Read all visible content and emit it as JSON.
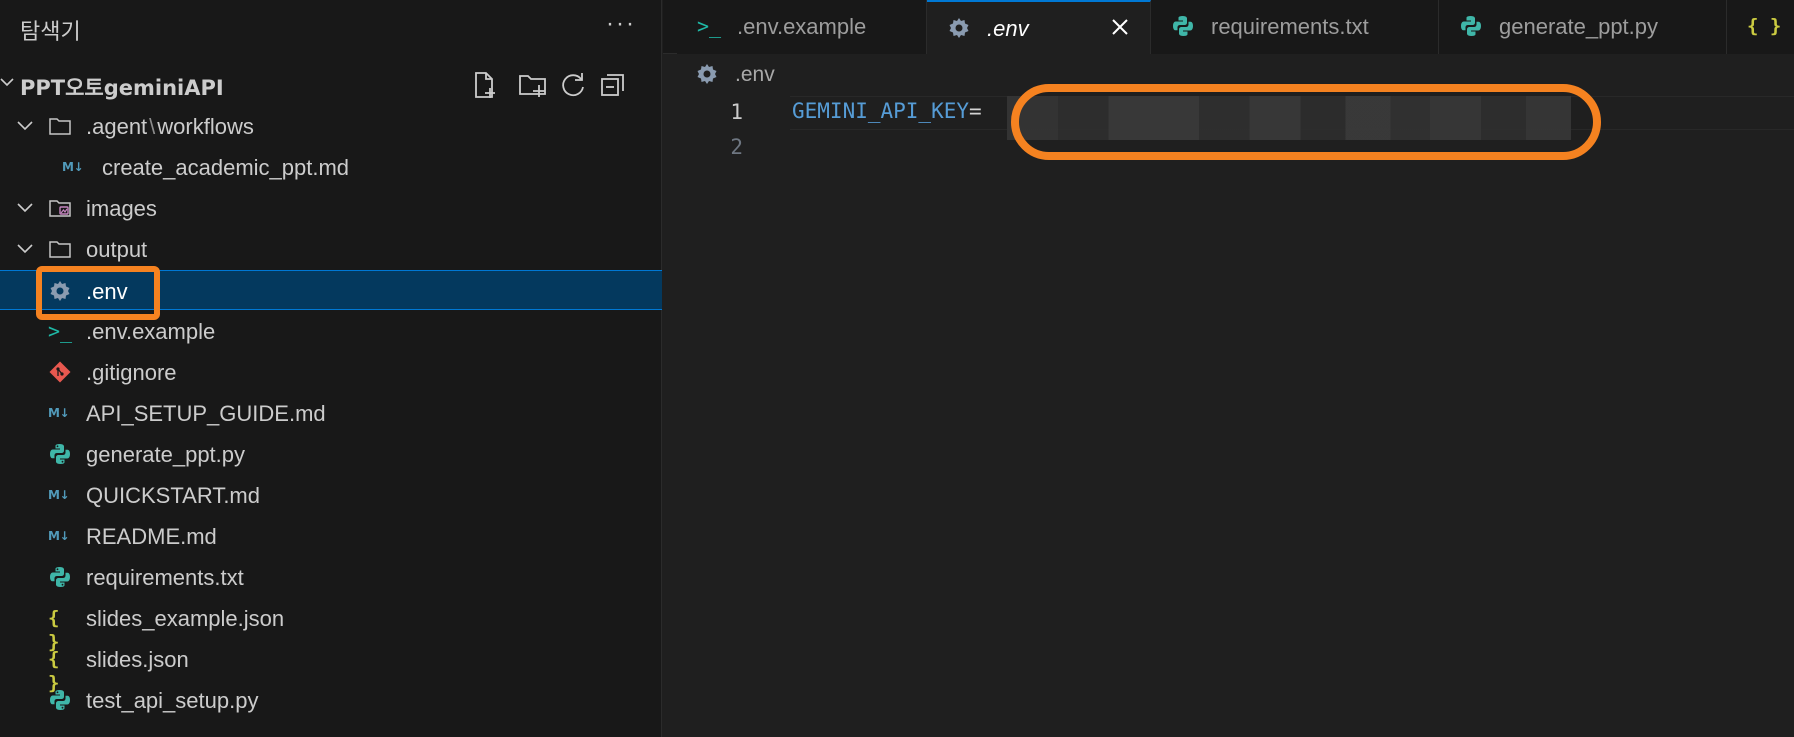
{
  "explorer": {
    "title": "탐색기",
    "more_label": "···",
    "root": {
      "label": "PPT오토geminiAPI",
      "actions": [
        "new-file-icon",
        "new-folder-icon",
        "refresh-icon",
        "collapse-all-icon"
      ]
    },
    "items": [
      {
        "label": ".agent",
        "label_sub": "workflows",
        "kind": "folder",
        "icon": "folder-icon"
      },
      {
        "label": "create_academic_ppt.md",
        "kind": "file",
        "icon": "markdown-icon"
      },
      {
        "label": "images",
        "kind": "folder",
        "icon": "images-folder-icon"
      },
      {
        "label": "output",
        "kind": "folder",
        "icon": "folder-icon"
      },
      {
        "label": ".env",
        "kind": "file",
        "icon": "gear-icon",
        "selected": true
      },
      {
        "label": ".env.example",
        "kind": "file",
        "icon": "terminal-icon"
      },
      {
        "label": ".gitignore",
        "kind": "file",
        "icon": "git-icon"
      },
      {
        "label": "API_SETUP_GUIDE.md",
        "kind": "file",
        "icon": "markdown-icon"
      },
      {
        "label": "generate_ppt.py",
        "kind": "file",
        "icon": "python-icon"
      },
      {
        "label": "QUICKSTART.md",
        "kind": "file",
        "icon": "markdown-icon"
      },
      {
        "label": "README.md",
        "kind": "file",
        "icon": "markdown-icon"
      },
      {
        "label": "requirements.txt",
        "kind": "file",
        "icon": "python-icon"
      },
      {
        "label": "slides_example.json",
        "kind": "file",
        "icon": "json-icon"
      },
      {
        "label": "slides.json",
        "kind": "file",
        "icon": "json-icon"
      },
      {
        "label": "test_api_setup.py",
        "kind": "file",
        "icon": "python-icon"
      }
    ],
    "md_glyph": "M↓",
    "json_glyph": "{ }",
    "term_glyph": ">_"
  },
  "tabs": [
    {
      "label": ".env.example",
      "icon": "terminal-icon",
      "active": false
    },
    {
      "label": ".env",
      "icon": "gear-icon",
      "active": true
    },
    {
      "label": "requirements.txt",
      "icon": "python-icon",
      "active": false
    },
    {
      "label": "generate_ppt.py",
      "icon": "python-icon",
      "active": false
    },
    {
      "label": "{ }",
      "icon": "json-icon",
      "active": false
    }
  ],
  "editor": {
    "breadcrumb": ".env",
    "line_numbers": [
      "1",
      "2"
    ],
    "code_key": "GEMINI_API_KEY",
    "code_eq": "="
  },
  "colors": {
    "highlight": "#f58220",
    "selection": "#04395e",
    "accent": "#0078d4"
  }
}
